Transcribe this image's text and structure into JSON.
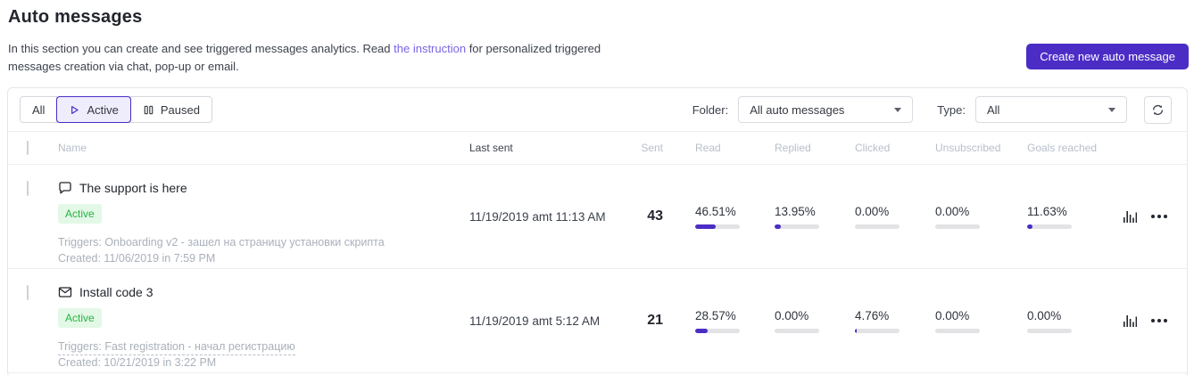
{
  "page": {
    "title": "Auto messages",
    "description_before_link": "In this section you can create and see triggered messages analytics. Read ",
    "description_link": "the instruction",
    "description_after_link": " for personalized triggered messages creation via chat, pop-up or email.",
    "create_button": "Create new auto message"
  },
  "toolbar": {
    "tabs": {
      "all": "All",
      "active": "Active",
      "paused": "Paused"
    },
    "active_tab": "Active",
    "folder_label": "Folder:",
    "folder_value": "All auto messages",
    "type_label": "Type:",
    "type_value": "All"
  },
  "table": {
    "columns": {
      "name": "Name",
      "last_sent": "Last sent",
      "sent": "Sent",
      "read": "Read",
      "replied": "Replied",
      "clicked": "Clicked",
      "unsubscribed": "Unsubscribed",
      "goals_reached": "Goals reached"
    },
    "rows": [
      {
        "icon": "chat-bubble",
        "name": "The support is here",
        "status": "Active",
        "triggers": "Triggers: Onboarding v2 - зашел на страницу установки скрипта",
        "created": "Created: 11/06/2019 in 7:59 PM",
        "last_sent": "11/19/2019 amt 11:13 AM",
        "sent": "43",
        "read": "46.51%",
        "replied": "13.95%",
        "clicked": "0.00%",
        "unsubscribed": "0.00%",
        "goals_reached": "11.63%"
      },
      {
        "icon": "envelope",
        "name": "Install code 3",
        "status": "Active",
        "triggers": "Triggers: Fast registration - начал регистрацию",
        "created": "Created: 10/21/2019 in 3:22 PM",
        "last_sent": "11/19/2019 amt 5:12 AM",
        "sent": "21",
        "read": "28.57%",
        "replied": "0.00%",
        "clicked": "4.76%",
        "unsubscribed": "0.00%",
        "goals_reached": "0.00%"
      }
    ]
  },
  "colors": {
    "accent_purple": "#4b2dc6",
    "link_purple": "#7b63e4",
    "badge_green_bg": "#e3f8e6",
    "badge_green_text": "#27b342",
    "progress_track": "#e3e3e6"
  }
}
